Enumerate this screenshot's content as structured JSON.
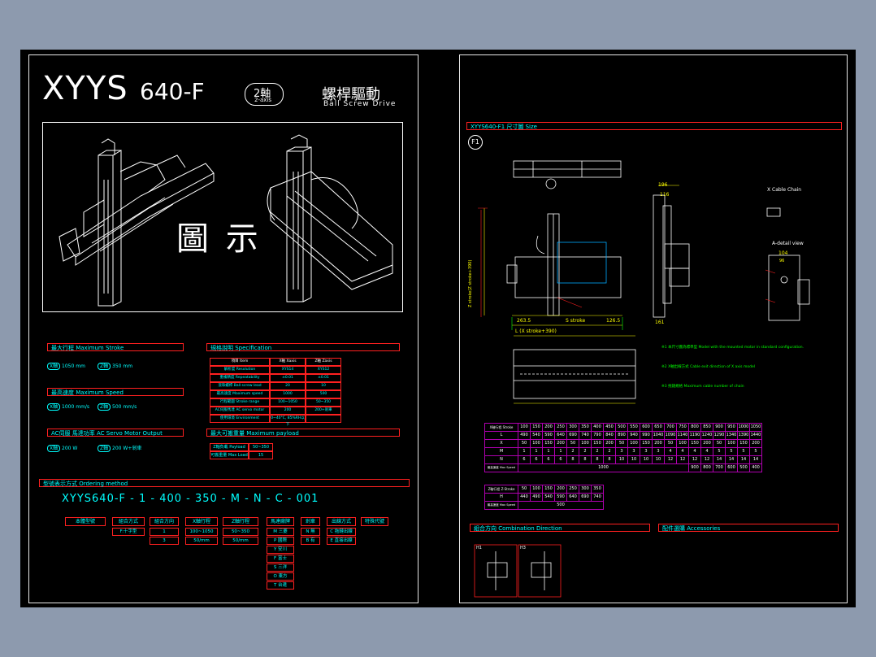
{
  "title": {
    "model": "XYYS",
    "code": "640-F",
    "axis_badge": "2軸",
    "axis_sub": "2-axis",
    "drive_cn": "螺桿驅動",
    "drive_en": "Ball Screw Drive"
  },
  "illustration": {
    "label": "圖 示"
  },
  "sections": {
    "stroke": "最大行程 Maximum Stroke",
    "spec": "規格說明 Specification",
    "speed": "最高速度 Maximum Speed",
    "motor": "AC伺服 馬達功率 AC Servo Motor Output",
    "payload": "最大可搬重量 Maximum payload",
    "ordering": "型號表示方式 Ordering method"
  },
  "stroke": {
    "x_tag": "X軸",
    "x_val": "1050 mm",
    "z_tag": "Z軸",
    "z_val": "350 mm"
  },
  "speed": {
    "x_tag": "X軸",
    "x_val": "1000 mm/s",
    "z_tag": "Z軸",
    "z_val": "500 mm/s"
  },
  "motor": {
    "x_tag": "X軸",
    "x_val": "200 W",
    "z_tag": "Z軸",
    "z_val": "200 W+剎車"
  },
  "spec_table": {
    "headers": [
      "項目 Item",
      "X軸 Xaxis",
      "Z軸 Zaxis"
    ],
    "rows": [
      [
        "解析度 Resolution",
        "XYS14",
        "XYS12"
      ],
      [
        "重複精度 Repeatability",
        "±0.01",
        "±0.01"
      ],
      [
        "滾珠螺桿 Ball screw lead",
        "20",
        "10"
      ],
      [
        "最高速度 Maximum speed",
        "1000",
        "500"
      ],
      [
        "行程範圍 Stroke range",
        "100~1050",
        "50~350"
      ],
      [
        "AC伺服馬達 AC servo motor",
        "200",
        "200+剎車"
      ],
      [
        "使用環境 Environment",
        "0~40°C, 85%RH以下",
        ""
      ]
    ]
  },
  "payload_table": {
    "label": "Z軸負載 Payload",
    "value": "50~350",
    "label2": "可搬重量 Max Load",
    "value2": "15"
  },
  "ordering": {
    "code_parts": [
      "XYYS640-F",
      "1",
      "400",
      "350",
      "M",
      "N",
      "C",
      "001"
    ],
    "headers": [
      "本體型號",
      "組合方式",
      "組合方向",
      "X軸行程",
      "Z軸行程",
      "馬達廠牌",
      "剎車",
      "出線方式",
      "特殊代號"
    ],
    "row1": [
      "",
      "F:十字型",
      "1",
      "100~1050",
      "50~350",
      "M 三菱",
      "N 無",
      "C 拖鏈出線",
      ""
    ],
    "row2": [
      "",
      "",
      "3",
      "50/mm",
      "50/mm",
      "P 國際",
      "B 有",
      "E 直接出線",
      ""
    ],
    "motors": [
      "Y 安川",
      "F 富士",
      "S 三洋",
      "O 東方",
      "T 台達"
    ]
  },
  "right": {
    "size_title": "XYYS640-F1 尺寸圖 Size",
    "f1": "F1",
    "cable_chain": "X Cable Chain",
    "detail_view": "A-detail view",
    "dims": {
      "stroke_z": "Z stroke(Z stroke+390)",
      "stroke_x": "S stroke",
      "total": "L (X stroke+390)",
      "d1": "263.5",
      "d2": "126.5",
      "d3": "196",
      "d4": "116",
      "d5": "161",
      "d6": "104",
      "d7": "96"
    },
    "notes": [
      "※1 本尺寸圖為標準型 Model with the mounted motor in standard configuration.",
      "※2 X軸出線方式 Cable exit direction of X axis model",
      "※3 拖鏈規格 Maximum cable number of chain"
    ],
    "table_x_header": "X軸行程 Stroke",
    "x_strokes": [
      "100",
      "150",
      "200",
      "250",
      "300",
      "350",
      "400",
      "450",
      "500",
      "550",
      "600",
      "650",
      "700",
      "750",
      "800",
      "850",
      "900",
      "950",
      "1000",
      "1050"
    ],
    "rows_x": [
      {
        "k": "L",
        "v": [
          "490",
          "540",
          "590",
          "640",
          "690",
          "740",
          "790",
          "840",
          "890",
          "940",
          "990",
          "1040",
          "1090",
          "1140",
          "1190",
          "1240",
          "1290",
          "1340",
          "1390",
          "1440"
        ]
      },
      {
        "k": "X",
        "v": [
          "50",
          "100",
          "150",
          "200",
          "50",
          "100",
          "150",
          "200",
          "50",
          "100",
          "150",
          "200",
          "50",
          "100",
          "150",
          "200",
          "50",
          "100",
          "150",
          "200"
        ]
      },
      {
        "k": "M",
        "v": [
          "1",
          "1",
          "1",
          "1",
          "2",
          "2",
          "2",
          "2",
          "3",
          "3",
          "3",
          "3",
          "4",
          "4",
          "4",
          "4",
          "5",
          "5",
          "5",
          "5"
        ]
      },
      {
        "k": "N",
        "v": [
          "6",
          "6",
          "6",
          "6",
          "8",
          "8",
          "8",
          "8",
          "10",
          "10",
          "10",
          "10",
          "12",
          "12",
          "12",
          "12",
          "14",
          "14",
          "14",
          "14"
        ]
      }
    ],
    "row_max_speed": {
      "k": "最高速度 Max Speed",
      "v1": "1000",
      "v2": [
        "900",
        "800",
        "700",
        "600",
        "500",
        "400"
      ]
    },
    "table_z_header": "Z軸行程 Z-Stroke",
    "z_strokes": [
      "50",
      "100",
      "150",
      "200",
      "250",
      "300",
      "350"
    ],
    "row_h": {
      "k": "H",
      "v": [
        "440",
        "490",
        "540",
        "590",
        "640",
        "690",
        "740"
      ]
    },
    "row_z_speed": {
      "k": "最高速度 Max Speed",
      "v": "500"
    },
    "combination": "組合方向 Combination Direction",
    "accessories": "配件選購 Accessories",
    "h1": "H1",
    "h3": "H3"
  },
  "colors": {
    "border": "#ff2020",
    "text": "#00ffff",
    "background": "#000000",
    "frame": "#8d9aae"
  }
}
